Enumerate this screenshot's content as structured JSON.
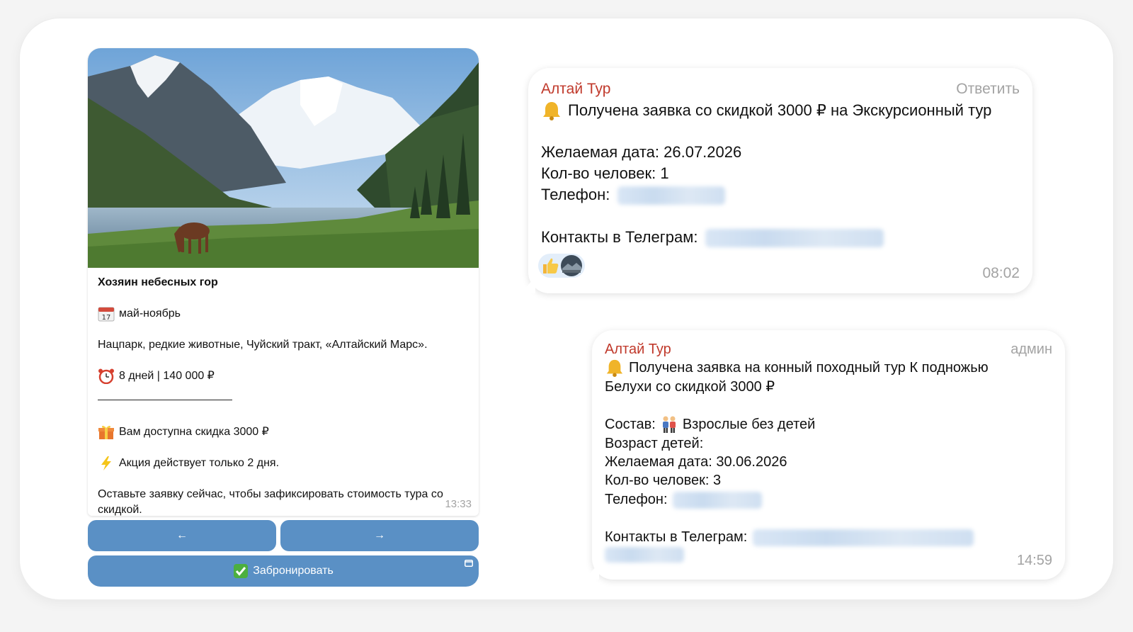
{
  "post": {
    "title": "Хозяин небесных гор",
    "season": "май-ноябрь",
    "description": "Нацпарк, редкие животные, Чуйский тракт, «Алтайский Марс».",
    "duration_price": "8 дней | 140 000 ₽",
    "discount": "Вам доступна скидка 3000 ₽",
    "promo": "Акция действует только 2 дня.",
    "cta_line1": "Оставьте заявку сейчас, чтобы зафиксировать стоимость тура со",
    "cta_line2": "скидкой.",
    "time": "13:33",
    "calendar_day": "17",
    "buttons": {
      "prev": "←",
      "next": "→",
      "book": "Забронировать"
    }
  },
  "message1": {
    "sender": "Алтай Тур",
    "action": "Ответить",
    "headline": "Получена заявка со скидкой 3000 ₽ на Экскурсионный тур",
    "date_line": "Желаемая дата: 26.07.2026",
    "people_line": "Кол-во человек: 1",
    "phone_label": "Телефон:",
    "contacts_label": "Контакты в Телеграм:",
    "time": "08:02"
  },
  "message2": {
    "sender": "Алтай Тур",
    "role": "админ",
    "headline_line1": "Получена заявка на конный походный тур К подножью",
    "headline_line2": "Белухи со скидкой 3000 ₽",
    "composition_label": "Состав:",
    "composition_value": "Взрослые без детей",
    "children_age": "Возраст детей:",
    "date_line": "Желаемая дата: 30.06.2026",
    "people_line": "Кол-во человек: 3",
    "phone_label": "Телефон:",
    "contacts_label": "Контакты в Телеграм:",
    "time": "14:59"
  },
  "colors": {
    "sender": "#c0392b",
    "button": "#5a90c5",
    "muted": "#a3a3a3"
  }
}
